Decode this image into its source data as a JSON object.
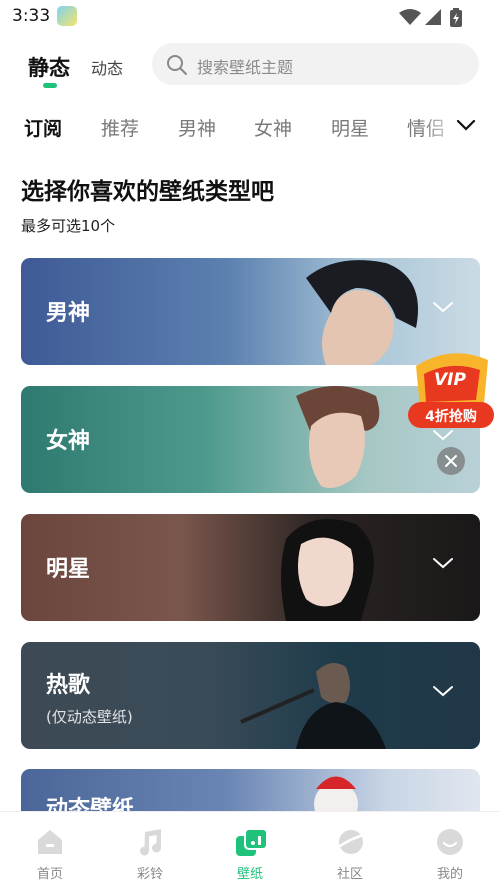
{
  "status_bar": {
    "time": "3:33"
  },
  "header": {
    "tab_static": "静态",
    "tab_dynamic": "动态",
    "search": {
      "placeholder": "搜索壁纸主题"
    }
  },
  "categories": [
    "订阅",
    "推荐",
    "男神",
    "女神",
    "明星",
    "情侣"
  ],
  "prompt": {
    "title": "选择你喜欢的壁纸类型吧",
    "subtitle": "最多可选10个"
  },
  "cards": [
    {
      "label": "男神",
      "sub": ""
    },
    {
      "label": "女神",
      "sub": ""
    },
    {
      "label": "明星",
      "sub": ""
    },
    {
      "label": "热歌",
      "sub": "(仅动态壁纸)"
    },
    {
      "label": "动态壁纸",
      "sub": ""
    }
  ],
  "promo": {
    "badge": "VIP",
    "text": "4折抢购"
  },
  "tabbar": [
    "首页",
    "彩铃",
    "壁纸",
    "社区",
    "我的"
  ],
  "colors": {
    "accent": "#1ec27a",
    "promo": "#e8381f"
  }
}
